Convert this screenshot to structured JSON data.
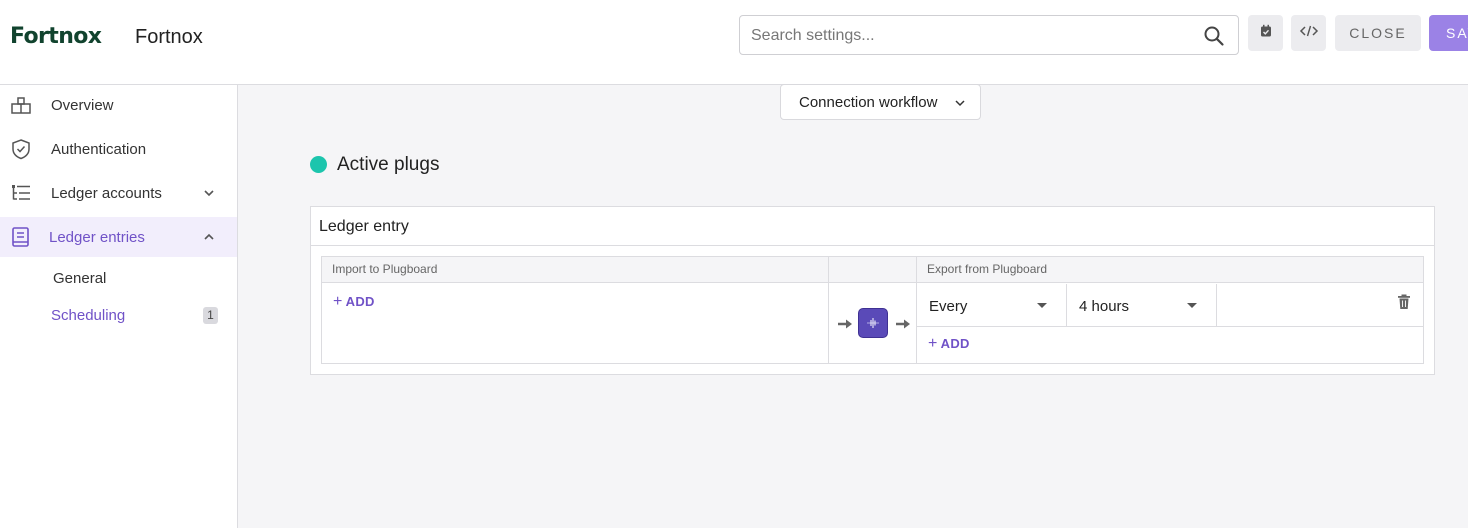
{
  "header": {
    "logo_text": "Fortnox",
    "app_title": "Fortnox",
    "search_placeholder": "Search settings...",
    "close_label": "CLOSE",
    "save_label": "SAVE"
  },
  "sidebar": {
    "items": [
      {
        "label": "Overview",
        "icon": "home-icon"
      },
      {
        "label": "Authentication",
        "icon": "shield-icon"
      },
      {
        "label": "Ledger accounts",
        "icon": "tree-list-icon"
      },
      {
        "label": "Ledger entries",
        "icon": "book-icon"
      }
    ],
    "sub_items": [
      {
        "label": "General"
      },
      {
        "label": "Scheduling",
        "badge": "1"
      }
    ]
  },
  "main": {
    "workflow_label": "Connection workflow",
    "section_title": "Active plugs",
    "card": {
      "title": "Ledger entry",
      "import_header": "Import to Plugboard",
      "export_header": "Export from Plugboard",
      "import_add": "ADD",
      "export_add": "ADD",
      "schedule_every": "Every",
      "schedule_interval": "4 hours"
    }
  },
  "colors": {
    "accent": "#7052c7",
    "save_button": "#9b82e6",
    "active_dot": "#1cc5ad",
    "logo": "#11432e"
  }
}
